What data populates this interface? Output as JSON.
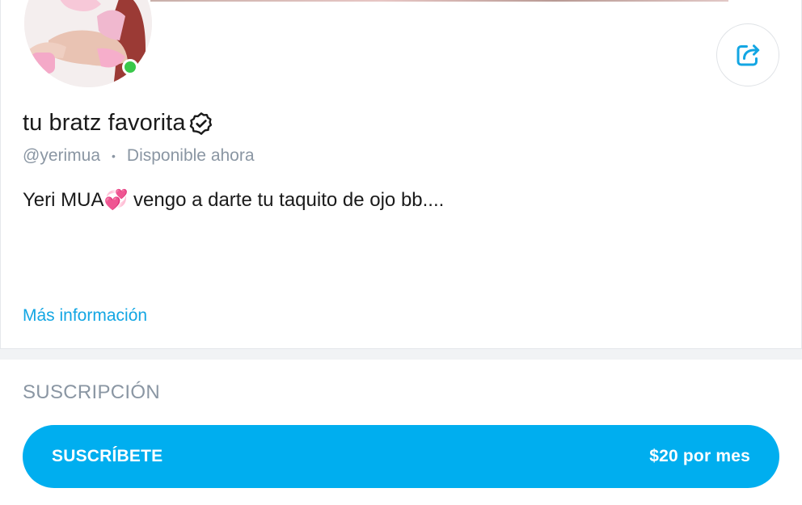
{
  "profile": {
    "display_name": "tu bratz favorita",
    "handle": "@yerimua",
    "status": "Disponible ahora",
    "bio": "Yeri MUA💞 vengo a darte tu taquito de ojo bb....",
    "more_info_link": "Más información",
    "online": true
  },
  "icons": {
    "share": "share-icon",
    "verified": "verified-badge-icon"
  },
  "subscription": {
    "section_title": "SUSCRIPCIÓN",
    "button_label": "SUSCRÍBETE",
    "price_label": "$20 por mes"
  },
  "colors": {
    "accent": "#00aeef",
    "link": "#13a6e3",
    "online": "#39c84a",
    "muted_text": "#8a96a3"
  }
}
